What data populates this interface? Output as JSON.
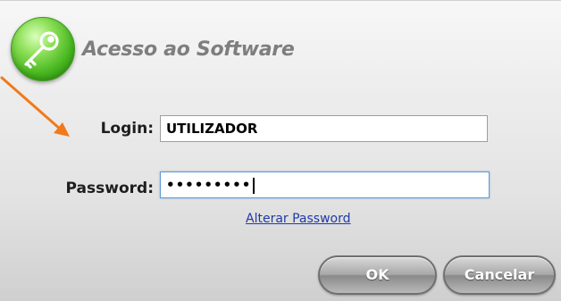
{
  "dialog": {
    "title": "Acesso ao Software",
    "login_label": "Login:",
    "login_value": "UTILIZADOR",
    "password_label": "Password:",
    "password_masked": "•••••••••",
    "change_password_link": "Alterar Password",
    "ok_label": "OK",
    "cancel_label": "Cancelar"
  },
  "icons": {
    "key": "key-icon",
    "arrow": "pointer-arrow-icon"
  },
  "colors": {
    "badge_green": "#45b51d",
    "link_blue": "#1f3aa8",
    "arrow_orange": "#f07a1c"
  }
}
